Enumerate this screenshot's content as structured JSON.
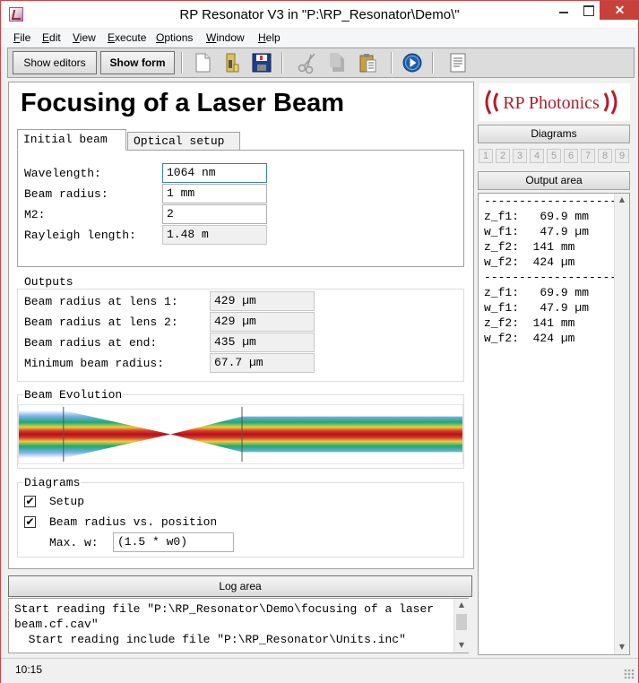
{
  "window": {
    "title": "RP Resonator V3 in \"P:\\RP_Resonator\\Demo\\\"",
    "close_glyph": "✕"
  },
  "menu": [
    "File",
    "Edit",
    "View",
    "Execute",
    "Options",
    "Window",
    "Help"
  ],
  "toolbar": {
    "show_editors_label": "Show editors",
    "show_form_label": "Show form",
    "icons": [
      "new-file-icon",
      "open-folder-icon",
      "save-icon",
      "cut-icon",
      "copy-icon",
      "paste-icon",
      "run-icon",
      "output-icon"
    ]
  },
  "form": {
    "title": "Focusing of a Laser Beam",
    "tabs": [
      {
        "label": "Initial beam",
        "active": true
      },
      {
        "label": "Optical setup",
        "active": false
      }
    ],
    "inputs": {
      "wavelength": {
        "label": "Wavelength:",
        "value": "1064 nm"
      },
      "beam_radius": {
        "label": "Beam radius:",
        "value": "1 mm"
      },
      "m2": {
        "label": "M2:",
        "value": "2"
      },
      "rayleigh": {
        "label": "Rayleigh length:",
        "value": "1.48 m"
      }
    },
    "outputs": {
      "title": "Outputs",
      "lens1": {
        "label": "Beam radius at lens 1:",
        "value": "429 µm"
      },
      "lens2": {
        "label": "Beam radius at lens 2:",
        "value": "429 µm"
      },
      "end": {
        "label": "Beam radius at end:",
        "value": "435 µm"
      },
      "min": {
        "label": "Minimum beam radius:",
        "value": "67.7 µm"
      }
    },
    "evolution": {
      "title": "Beam Evolution"
    },
    "diagrams": {
      "title": "Diagrams",
      "setup": {
        "label": "Setup",
        "checked": true,
        "mark": "✔"
      },
      "beam_radius_pos": {
        "label": "Beam radius vs. position",
        "checked": true,
        "mark": "✔"
      },
      "max_w": {
        "label": "Max. w:",
        "value": "(1.5 * w0)"
      }
    }
  },
  "log": {
    "header": "Log area",
    "text": "Start reading file \"P:\\RP_Resonator\\Demo\\focusing of a laser beam.cf.cav\"\n  Start reading include file \"P:\\RP_Resonator\\Units.inc\""
  },
  "right": {
    "logo_text": "RP Photonics",
    "diagrams_label": "Diagrams",
    "diagram_numbers": [
      "1",
      "2",
      "3",
      "4",
      "5",
      "6",
      "7",
      "8",
      "9"
    ],
    "output_label": "Output area",
    "output_separator": "----------------------",
    "output_blocks": [
      [
        "z_f1:   69.9 mm",
        "w_f1:   47.9 µm",
        "z_f2:  141 mm",
        "w_f2:  424 µm"
      ],
      [
        "z_f1:   69.9 mm",
        "w_f1:   47.9 µm",
        "z_f2:  141 mm",
        "w_f2:  424 µm"
      ]
    ]
  },
  "status": {
    "time": "10:15"
  },
  "colors": {
    "accent_blue": "#1f5fa8",
    "close_red": "#c7413a",
    "logo_red": "#b21d2b"
  }
}
